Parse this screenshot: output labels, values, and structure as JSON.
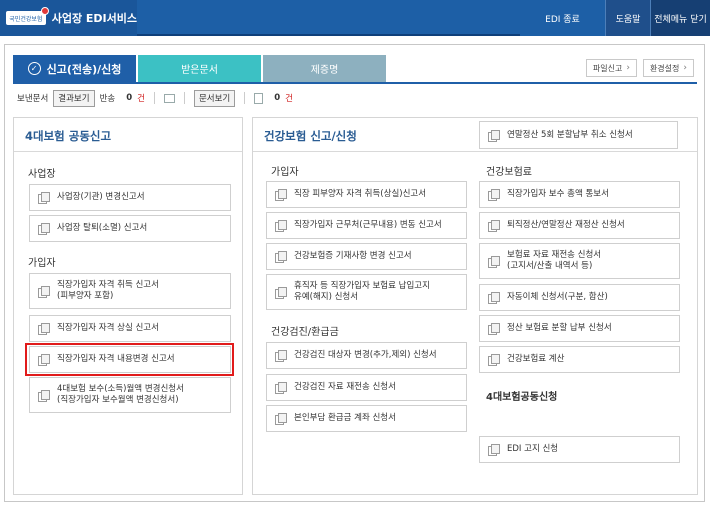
{
  "topbar": {
    "logo_text": "국민건강보험",
    "title": "사업장 EDI서비스",
    "edi_end": "EDI 종료",
    "help": "도움말",
    "close_all": "전체메뉴 닫기"
  },
  "tabs": {
    "active": "신고(전송)/신청",
    "received": "받은문서",
    "certificate": "제증명"
  },
  "right_links": {
    "file_report": "파일신고",
    "settings": "환경설정"
  },
  "status": {
    "sent_label": "보낸문서",
    "result_view": "결과보기",
    "return_label": "반송",
    "return_count": "0",
    "count_unit": "건",
    "doc_view": "문서보기",
    "doc_count": "0",
    "doc_unit": "건"
  },
  "left_panel": {
    "title": "4대보험 공동신고",
    "workplace_section": "사업장",
    "workplace_items": [
      "사업장(기관) 변경신고서",
      "사업장 탈퇴(소멸) 신고서"
    ],
    "subscriber_section": "가입자",
    "subscriber_items": [
      [
        "직장가입자 자격 취득 신고서",
        "(피부양자 포함)"
      ],
      [
        "직장가입자 자격 상실 신고서"
      ],
      [
        "직장가입자 자격 내용변경 신고서"
      ],
      [
        "4대보험 보수(소득)월액 변경신청서",
        "(직장가입자 보수월액 변경신청서)"
      ]
    ]
  },
  "right_panel": {
    "title": "건강보험 신고/신청",
    "top_item": "연말정산 5회 분할납부 취소 신청서",
    "subscriber_section": "가입자",
    "subscriber_items": [
      [
        "직장 피부양자 자격 취득(상실)신고서"
      ],
      [
        "직장가입자 근무처(근무내용) 변동 신고서"
      ],
      [
        "건강보험증 기재사항 변경 신고서"
      ],
      [
        "휴직자 등 직장가입자 보험료 납입고지",
        "유예(해지) 신청서"
      ]
    ],
    "checkup_section": "건강검진/환급금",
    "checkup_items": [
      "건강검진 대상자 변경(추가,제외) 신청서",
      "건강검진 자료 재전송 신청서",
      "본인부담 환급금 계좌 신청서"
    ],
    "premium_section": "건강보험료",
    "premium_items": [
      [
        "직장가입자 보수 총액 통보서"
      ],
      [
        "퇴직정산/연말정산 재정산 신청서"
      ],
      [
        "보험료 자료 재전송 신청서",
        "(고지서/산출 내역서 등)"
      ],
      [
        "자동이체 신청서(구분, 합산)"
      ],
      [
        "정산 보험료 분할 납부 신청서"
      ],
      [
        "건강보험료 계산"
      ]
    ],
    "joint_section": "4대보험공동신청",
    "joint_items": [
      "EDI 고지 신청"
    ]
  }
}
